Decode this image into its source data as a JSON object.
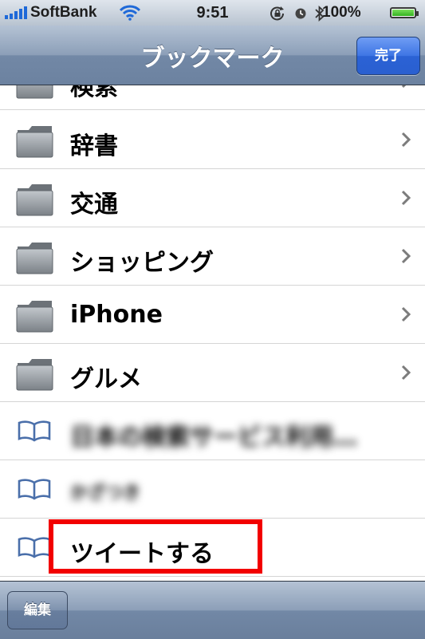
{
  "status_bar": {
    "carrier": "SoftBank",
    "time": "9:51",
    "battery_percent": "100%",
    "battery_level": 1.0,
    "icons": [
      "signal-icon",
      "wifi-icon",
      "rotation-lock-icon",
      "alarm-icon",
      "bluetooth-icon",
      "battery-icon"
    ]
  },
  "nav": {
    "title": "ブックマーク",
    "done_label": "完了"
  },
  "list": {
    "items": [
      {
        "label": "検索",
        "type": "folder"
      },
      {
        "label": "辞書",
        "type": "folder"
      },
      {
        "label": "交通",
        "type": "folder"
      },
      {
        "label": "ショッピング",
        "type": "folder"
      },
      {
        "label": "iPhone",
        "type": "folder"
      },
      {
        "label": "グルメ",
        "type": "folder"
      },
      {
        "label": "日本の検索サービス利用…",
        "type": "bookmark",
        "obscured": true
      },
      {
        "label": "かざつき",
        "type": "bookmark",
        "obscured": true
      },
      {
        "label": "ツイートする",
        "type": "bookmark",
        "highlighted": true
      }
    ]
  },
  "toolbar": {
    "edit_label": "編集"
  },
  "colors": {
    "accent_blue": "#2a62d5",
    "bar_steel": "#7f93b0",
    "highlight_red": "#f20000"
  }
}
